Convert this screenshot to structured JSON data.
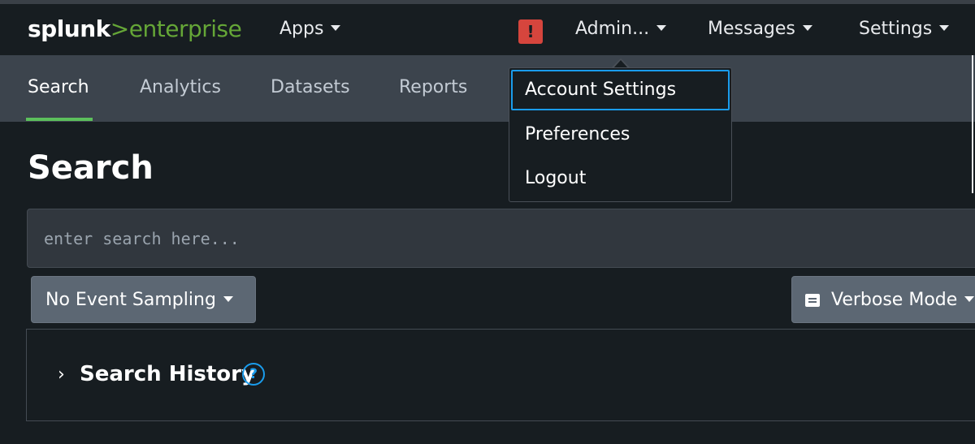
{
  "brand": {
    "name_main": "splunk",
    "name_sub": "enterprise"
  },
  "topnav": {
    "apps_label": "Apps",
    "alert_symbol": "!",
    "user_label": "Admin...",
    "messages_label": "Messages",
    "settings_label": "Settings"
  },
  "app_tabs": [
    {
      "label": "Search",
      "active": true
    },
    {
      "label": "Analytics",
      "active": false
    },
    {
      "label": "Datasets",
      "active": false
    },
    {
      "label": "Reports",
      "active": false
    }
  ],
  "user_menu": {
    "items": [
      {
        "label": "Account Settings",
        "focused": true
      },
      {
        "label": "Preferences",
        "focused": false
      },
      {
        "label": "Logout",
        "focused": false
      }
    ]
  },
  "page": {
    "title": "Search"
  },
  "search": {
    "placeholder": "enter search here..."
  },
  "controls": {
    "sampling_label": "No Event Sampling",
    "mode_label": "Verbose Mode"
  },
  "history": {
    "title": "Search History",
    "help_symbol": "?"
  },
  "colors": {
    "brand_green": "#65a637",
    "alert_red": "#d6453d",
    "focus_blue": "#1a9cec",
    "active_tab_underline": "#5cc05c"
  },
  "icons": [
    "caret-down-icon",
    "alert-icon",
    "chevron-right-icon",
    "help-icon",
    "event-mode-icon"
  ]
}
